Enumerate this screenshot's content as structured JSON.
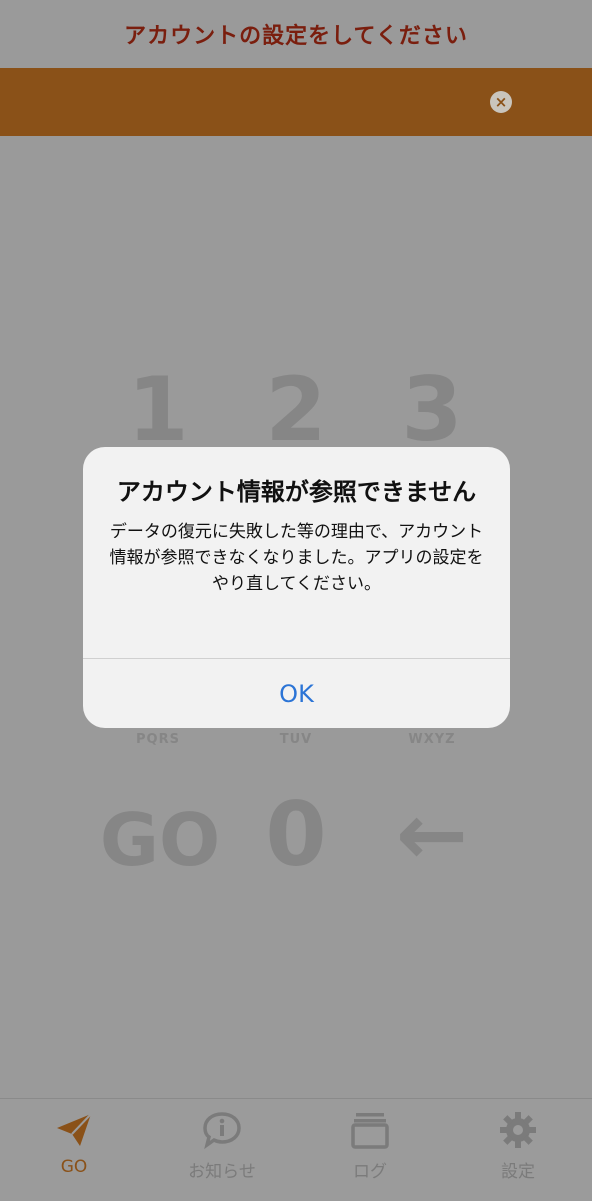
{
  "header": {
    "title": "アカウントの設定をしてください"
  },
  "banner": {
    "close_icon": "×"
  },
  "keypad": {
    "keys": [
      {
        "num": "1",
        "letters": ""
      },
      {
        "num": "2",
        "letters": ""
      },
      {
        "num": "3",
        "letters": ""
      },
      {
        "num": "",
        "letters": "PQRS"
      },
      {
        "num": "",
        "letters": "TUV"
      },
      {
        "num": "",
        "letters": "WXYZ"
      },
      {
        "num": "GO",
        "letters": ""
      },
      {
        "num": "0",
        "letters": ""
      },
      {
        "num": "←",
        "letters": ""
      }
    ]
  },
  "dialog": {
    "title": "アカウント情報が参照できません",
    "message": "データの復元に失敗した等の理由で、アカウント情報が参照できなくなりました。アプリの設定をやり直してください。",
    "ok_label": "OK"
  },
  "tabs": [
    {
      "label": "GO",
      "icon": "paper-plane-icon",
      "active": true
    },
    {
      "label": "お知らせ",
      "icon": "info-bubble-icon",
      "active": false
    },
    {
      "label": "ログ",
      "icon": "log-stack-icon",
      "active": false
    },
    {
      "label": "設定",
      "icon": "gear-icon",
      "active": false
    }
  ],
  "colors": {
    "accent": "#8a5118",
    "title_red": "#7a1e0e",
    "link_blue": "#2b74d6"
  }
}
